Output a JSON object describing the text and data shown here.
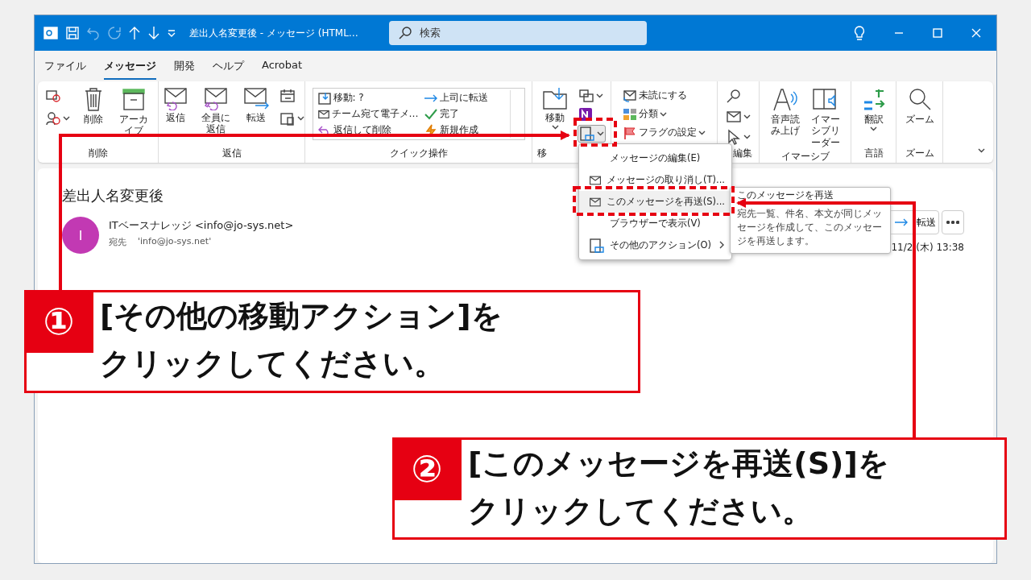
{
  "title_bar": {
    "title": "差出人名変更後 - メッセージ (HTML…",
    "search": {
      "placeholder": "検索"
    }
  },
  "menu_tabs": [
    {
      "label": "ファイル",
      "selected": false
    },
    {
      "label": "メッセージ",
      "selected": true
    },
    {
      "label": "開発",
      "selected": false
    },
    {
      "label": "ヘルプ",
      "selected": false
    },
    {
      "label": "Acrobat",
      "selected": false
    }
  ],
  "ribbon": {
    "groups": [
      {
        "kind": "large",
        "label": "削除",
        "buttons": [
          {
            "label": "削除",
            "has_menu": false
          },
          {
            "label": "アーカイブ",
            "has_menu": false
          }
        ]
      },
      {
        "kind": "large",
        "label": "返信",
        "buttons": [
          {
            "label": "返信",
            "has_menu": false
          },
          {
            "label": "全員に返信",
            "has_menu": false
          },
          {
            "label": "転送",
            "has_menu": false
          }
        ]
      },
      {
        "kind": "quick",
        "label": "クイック操作",
        "items": [
          "移動: ?",
          "チーム宛て電子メ…",
          "返信して削除",
          "上司に転送",
          "完了",
          "新規作成"
        ]
      },
      {
        "kind": "large",
        "label": "移",
        "buttons": [
          {
            "label": "移動",
            "has_menu": true
          }
        ]
      },
      {
        "kind": "small",
        "items": [
          "未読にする",
          "分類",
          "フラグの設定"
        ]
      },
      {
        "kind": "icons",
        "label": "編集"
      },
      {
        "kind": "large",
        "label": "イマーシブ",
        "buttons": [
          {
            "label": "音声読み上げ",
            "has_menu": false
          },
          {
            "label": "イマーシブリーダー",
            "has_menu": false
          }
        ]
      },
      {
        "kind": "large",
        "label": "言語",
        "buttons": [
          {
            "label": "翻訳",
            "has_menu": true
          }
        ]
      },
      {
        "kind": "large",
        "label": "ズーム",
        "buttons": [
          {
            "label": "ズーム",
            "has_menu": false
          }
        ]
      }
    ]
  },
  "message": {
    "subject": "差出人名変更後",
    "avatar": {
      "letter": "I",
      "color": "#c239b3"
    },
    "sender": "ITベースナレッジ <info@jo-sys.net>",
    "to_label": "宛先",
    "to": "'info@jo-sys.net'",
    "forward": "転送",
    "date": "11/2 (木) 13:38"
  },
  "dropdown": {
    "items": [
      {
        "label": "メッセージの編集(E)",
        "icon": false,
        "submenu": false,
        "selected": false
      },
      {
        "label": "メッセージの取り消し(T)...",
        "icon": true,
        "submenu": false,
        "selected": false
      },
      {
        "label": "このメッセージを再送(S)...",
        "icon": true,
        "submenu": false,
        "selected": true
      },
      {
        "label": "ブラウザーで表示(V)",
        "icon": false,
        "submenu": false,
        "selected": false
      },
      {
        "label": "その他のアクション(O)",
        "icon": true,
        "submenu": true,
        "selected": false
      }
    ]
  },
  "tooltip": {
    "title": "このメッセージを再送",
    "text": "宛先一覧、件名、本文が同じメッセージを作成して、このメッセージを再送します。"
  },
  "callouts": [
    {
      "number": "①",
      "lines": [
        "[その他の移動アクション]を",
        "クリックしてください。"
      ]
    },
    {
      "number": "②",
      "lines": [
        "[このメッセージを再送(S)]を",
        "クリックしてください。"
      ]
    }
  ]
}
